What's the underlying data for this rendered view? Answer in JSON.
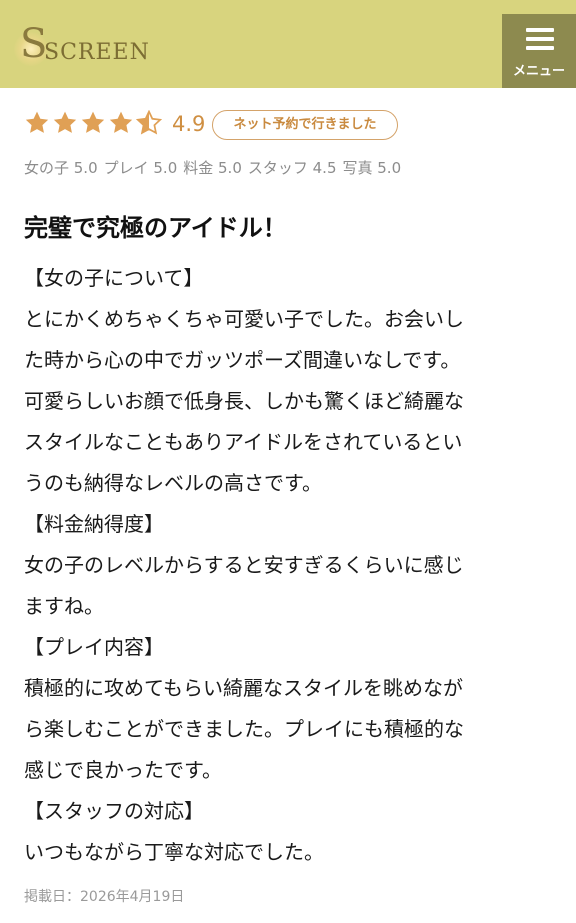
{
  "header": {
    "logo_text": "SCREEN",
    "menu_label": "メニュー",
    "accent_color": "#d8d47e",
    "menu_bg_color": "#8d8a4f"
  },
  "rating": {
    "stars_value": 4.9,
    "stars_max": 5,
    "score": "4.9",
    "badge": "ネット予約で行きました",
    "star_color": "#e0a055"
  },
  "sub_ratings": [
    {
      "label": "女の子",
      "value": "5.0"
    },
    {
      "label": "プレイ",
      "value": "5.0"
    },
    {
      "label": "料金",
      "value": "5.0"
    },
    {
      "label": "スタッフ",
      "value": "4.5"
    },
    {
      "label": "写真",
      "value": "5.0"
    }
  ],
  "review": {
    "title": "完璧で究極のアイドル！",
    "lines": [
      "【女の子について】",
      "とにかくめちゃくちゃ可愛い子でした。お会いし",
      "た時から心の中でガッツポーズ間違いなしです。",
      "可愛らしいお顔で低身長、しかも驚くほど綺麗な",
      "スタイルなこともありアイドルをされているとい",
      "うのも納得なレベルの高さです。",
      "【料金納得度】",
      "女の子のレベルからすると安すぎるくらいに感じ",
      "ますね。",
      "【プレイ内容】",
      "積極的に攻めてもらい綺麗なスタイルを眺めなが",
      "ら楽しむことができました。プレイにも積極的な",
      "感じで良かったです。",
      "【スタッフの対応】",
      "いつもながら丁寧な対応でした。"
    ]
  },
  "post_date": "掲載日：2026年4月19日"
}
